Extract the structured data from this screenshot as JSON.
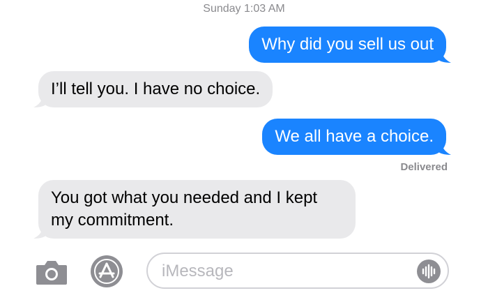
{
  "header": {
    "timestamp": "Sunday 1:03 AM"
  },
  "messages": [
    {
      "direction": "sent",
      "text": "Why did you sell us out"
    },
    {
      "direction": "received",
      "text": "I’ll tell you. I have no choice."
    },
    {
      "direction": "sent",
      "text": "We all have a choice."
    },
    {
      "direction": "received",
      "text": "You got what you needed and I kept my commitment."
    }
  ],
  "status": {
    "delivered": "Delivered"
  },
  "composer": {
    "placeholder": "iMessage",
    "icons": [
      "camera-icon",
      "app-store-icon",
      "audio-message-icon"
    ]
  },
  "colors": {
    "sent_bubble": "#1a84ff",
    "received_bubble": "#e9e9eb",
    "icon_gray": "#8e8e93"
  }
}
